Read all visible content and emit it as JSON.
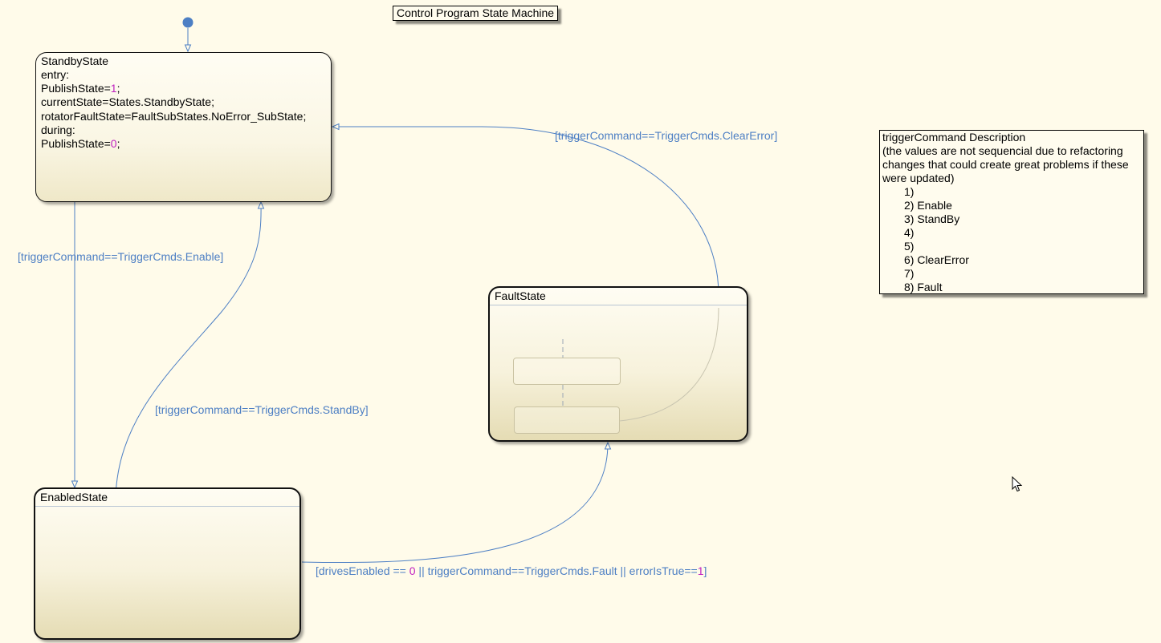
{
  "diagram": {
    "title": "Control Program State Machine",
    "states": {
      "standby": {
        "name": "StandbyState",
        "actions": [
          [
            {
              "t": "entry:"
            }
          ],
          [
            {
              "t": "PublishState="
            },
            {
              "t": "1",
              "num": true
            },
            {
              "t": ";"
            }
          ],
          [
            {
              "t": "currentState=States.StandbyState;"
            }
          ],
          [
            {
              "t": "rotatorFaultState=FaultSubStates.NoError_SubState;"
            }
          ],
          [
            {
              "t": "during:"
            }
          ],
          [
            {
              "t": "PublishState="
            },
            {
              "t": "0",
              "num": true
            },
            {
              "t": ";"
            }
          ]
        ]
      },
      "fault": {
        "name": "FaultState"
      },
      "enabled": {
        "name": "EnabledState"
      }
    },
    "transitions": {
      "standby_to_enabled": "[triggerCommand==TriggerCmds.Enable]",
      "enabled_to_standby": "[triggerCommand==TriggerCmds.StandBy]",
      "fault_to_standby": "[triggerCommand==TriggerCmds.ClearError]",
      "enabled_to_fault": [
        {
          "t": "[drivesEnabled == "
        },
        {
          "t": "0",
          "num": true
        },
        {
          "t": " || triggerCommand==TriggerCmds.Fault || errorIsTrue=="
        },
        {
          "t": "1",
          "num": true
        },
        {
          "t": "]"
        }
      ]
    },
    "note": {
      "heading": "triggerCommand Description",
      "body": "(the values are not sequencial due to refactoring changes that could create great problems if these were updated)",
      "items": [
        "1)",
        "2) Enable",
        "3) StandBy",
        "4)",
        "5)",
        "6) ClearError",
        "7)",
        "8) Fault"
      ]
    },
    "colors": {
      "transition": "#4d7fc4",
      "numeric_literal": "#c020c0",
      "background": "#fffbea"
    }
  }
}
